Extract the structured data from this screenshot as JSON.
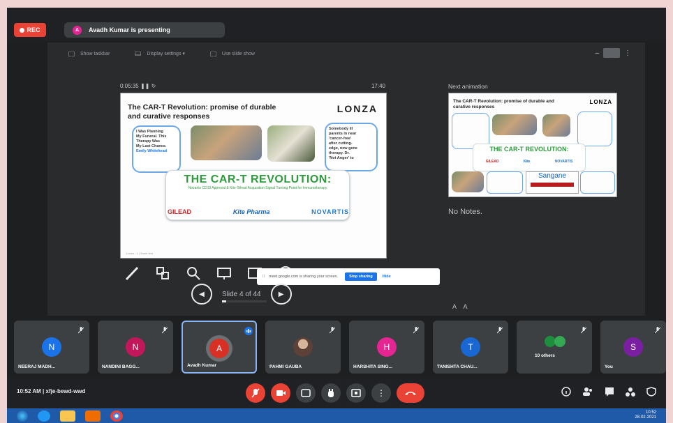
{
  "topbar": {
    "rec_label": "REC",
    "presenter_initial": "A",
    "presenting_text": "Avadh Kumar is presenting"
  },
  "presenter_toolbar": {
    "items": [
      "Show taskbar",
      "Display settings ▾",
      "Use slide show"
    ]
  },
  "presenter": {
    "timer": "0:05:35",
    "clock": "17:40",
    "next_label": "Next animation",
    "notes": "No Notes.",
    "font_controls": "A A",
    "slide_indicator": "Slide 4 of 44",
    "slide_progress_fraction": 0.09
  },
  "slide": {
    "title": "The CAR-T Revolution: promise of durable and curative responses",
    "logo": "LONZA",
    "left_bubble": [
      "I Was Planning",
      "My Funeral. This",
      "Therapy Was",
      "My Last Chance."
    ],
    "left_bubble_name": "Emily Whitehead",
    "right_bubble": [
      "Somebody ill",
      "parents in near",
      "'cancer-free'",
      "after cutting-",
      "edge, new gene",
      "therapy. Dr.",
      "'Not Anger' to"
    ],
    "banner_title": "THE CAR-T REVOLUTION:",
    "banner_subtitle": "Novartis CD19 Approval & Kite Gilead Acquisition Signal Turning Point for Immunotherapy",
    "companies": [
      "GILEAD",
      "Kite Pharma",
      "NOVARTIS"
    ],
    "footer": "Lonza - 1 | Some text"
  },
  "next_slide": {
    "title": "The CAR-T Revolution: promise of durable and curative responses",
    "logo": "LONZA",
    "banner_title": "THE CAR-T REVOLUTION:",
    "sangene": "Sangane",
    "companies": [
      "GILEAD",
      "Kite",
      "NOVARTIS"
    ]
  },
  "share_notice": {
    "text": "meet.google.com is sharing your screen.",
    "stop_label": "Stop sharing",
    "hide_label": "Hide"
  },
  "participants": [
    {
      "name": "NEERAJ MADH...",
      "initial": "N",
      "color": "#1a73e8"
    },
    {
      "name": "NANDINI BAGG...",
      "initial": "N",
      "color": "#c2185b"
    },
    {
      "name": "Avadh Kumar",
      "initial": "A",
      "color": "#d93025"
    },
    {
      "name": "PAHMI GAUBA",
      "initial": "",
      "color": "#6d4c41"
    },
    {
      "name": "HARSHITA SING...",
      "initial": "H",
      "color": "#e52592"
    },
    {
      "name": "TANISHTA CHAU...",
      "initial": "T",
      "color": "#1967d2"
    },
    {
      "name": "10 others",
      "initial": "",
      "color": "#1e8e3e"
    },
    {
      "name": "You",
      "initial": "S",
      "color": "#7b1fa2"
    }
  ],
  "bottombar": {
    "meeting_info": "10:52 AM  |  xfje-bewd-wwd"
  },
  "taskbar": {
    "time": "10:52",
    "date": "28-02-2021"
  }
}
